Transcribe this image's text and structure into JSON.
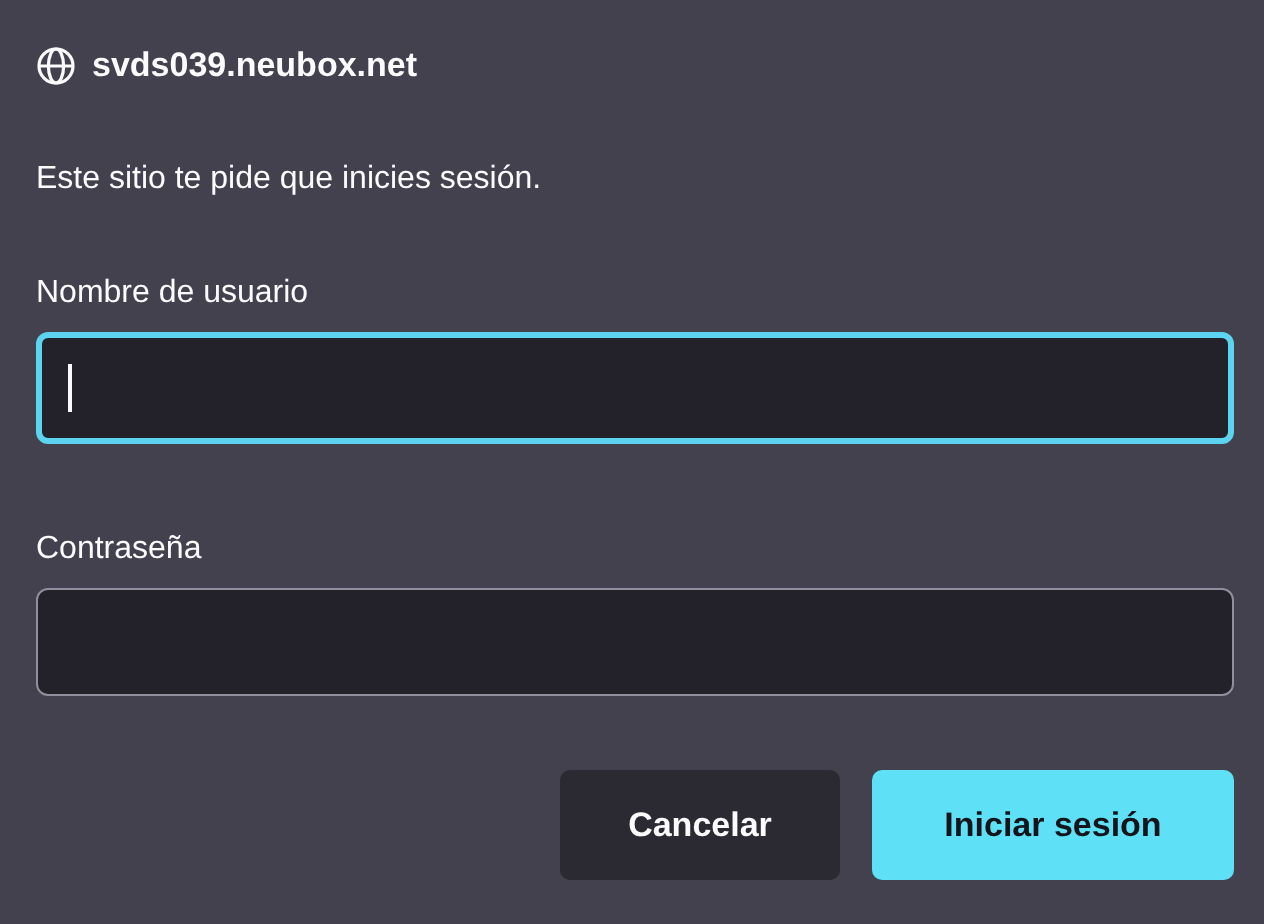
{
  "header": {
    "host": "svds039.neubox.net"
  },
  "message": "Este sitio te pide que inicies sesión.",
  "fields": [
    {
      "label": "Nombre de usuario",
      "focused": true
    },
    {
      "label": "Contraseña",
      "focused": false
    }
  ],
  "buttons": [
    {
      "label": "Cancelar",
      "kind": "secondary"
    },
    {
      "label": "Iniciar sesión",
      "kind": "primary"
    }
  ]
}
